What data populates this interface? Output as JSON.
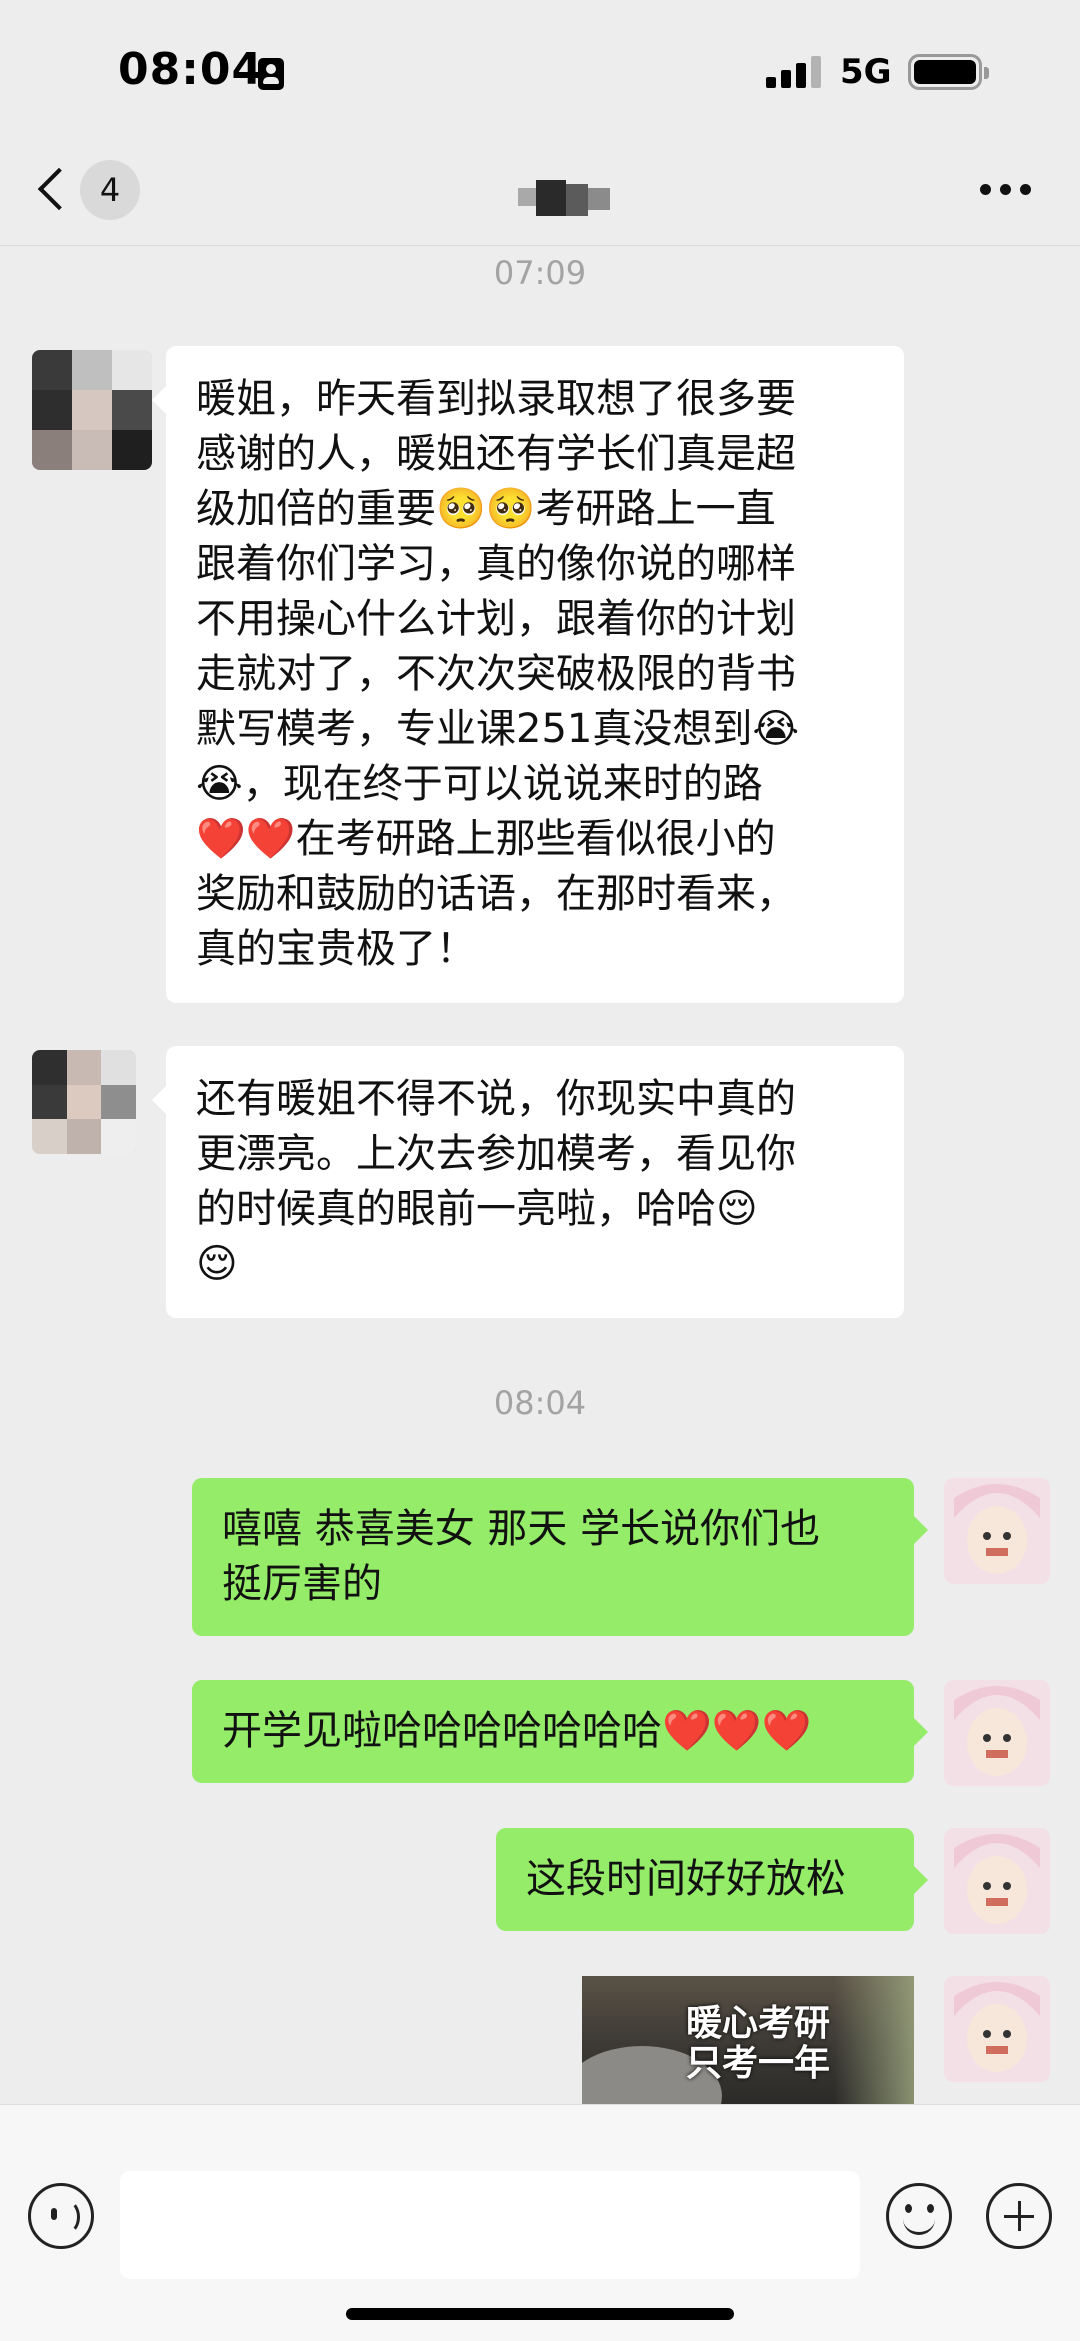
{
  "status_bar": {
    "time": "08:04",
    "network": "5G"
  },
  "nav": {
    "unread_count": "4"
  },
  "messages": {
    "timestamp_1": "07:09",
    "incoming_1_lines": [
      "暖姐，昨天看到拟录取想了很多要",
      "感谢的人，暖姐还有学长们真是超",
      "级加倍的重要🥺🥺考研路上一直",
      "跟着你们学习，真的像你说的哪样",
      "不用操心什么计划，跟着你的计划",
      "走就对了，不次次突破极限的背书",
      "默写模考，专业课251真没想到😭",
      "😭，现在终于可以说说来时的路",
      "❤️❤️在考研路上那些看似很小的",
      "奖励和鼓励的话语，在那时看来，",
      "真的宝贵极了！"
    ],
    "incoming_2_lines": [
      "还有暖姐不得不说，你现实中真的",
      "更漂亮。上次去参加模考，看见你",
      "的时候真的眼前一亮啦，哈哈😌",
      "😌"
    ],
    "timestamp_2": "08:04",
    "outgoing_1_lines": [
      "嘻嘻 恭喜美女 那天 学长说你们也",
      "挺厉害的"
    ],
    "outgoing_2": "开学见啦哈哈哈哈哈哈哈❤️❤️❤️",
    "outgoing_3": "这段时间好好放松",
    "image_caption_lines": [
      "暖心考研",
      "只考一年"
    ]
  },
  "colors": {
    "background": "#ededed",
    "outgoing_bubble": "#95ec69",
    "incoming_bubble": "#ffffff",
    "timestamp_text": "#a3a3a3"
  },
  "icons": [
    "back-chevron-icon",
    "more-icon",
    "voice-icon",
    "emoji-icon",
    "add-icon",
    "id-card-icon",
    "signal-icon",
    "battery-icon"
  ]
}
